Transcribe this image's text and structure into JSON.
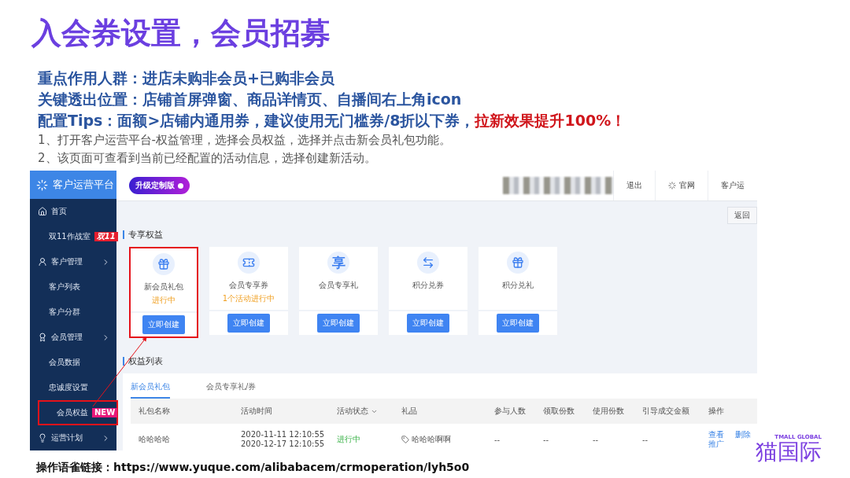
{
  "title": "入会券设置，会员招募",
  "key_points": [
    {
      "text": "重点作用人群：进店未购非会员+已购非会员"
    },
    {
      "text": "关键透出位置：店铺首屏弹窗、商品详情页、自播间右上角icon"
    },
    {
      "text": "配置Tips：面额>店铺内通用券，建议使用无门槛券/8折以下券，",
      "highlight": "拉新效果提升100%！"
    }
  ],
  "steps": [
    "1、打开客户运营平台-权益管理，选择会员权益，选择并点击新会员礼包功能。",
    "2、该页面可查看到当前已经配置的活动信息，选择创建新活动。"
  ],
  "app": {
    "brand": "客户运营平台",
    "upgrade_button": "升级定制版",
    "top_links": [
      {
        "label": "退出",
        "kind": "plain"
      },
      {
        "label": "官网",
        "kind": "icon"
      },
      {
        "label": "客户运",
        "kind": "plain"
      }
    ],
    "back_button": "返回",
    "sidebar": [
      {
        "label": "首页",
        "kind": "group",
        "annotated": false
      },
      {
        "label": "双11作战室",
        "kind": "sub",
        "badge": "双11",
        "annotated": false
      },
      {
        "label": "客户管理",
        "kind": "group",
        "annotated": false
      },
      {
        "label": "客户列表",
        "kind": "sub",
        "annotated": false
      },
      {
        "label": "客户分群",
        "kind": "sub",
        "annotated": false
      },
      {
        "label": "会员管理",
        "kind": "group",
        "annotated": false
      },
      {
        "label": "会员数据",
        "kind": "sub",
        "annotated": false
      },
      {
        "label": "忠诚度设置",
        "kind": "sub",
        "annotated": false
      },
      {
        "label": "会员权益",
        "kind": "sub",
        "badge": "NEW",
        "annotated": true
      },
      {
        "label": "运营计划",
        "kind": "group",
        "annotated": false
      }
    ],
    "benefits_title": "专享权益",
    "cards": [
      {
        "name": "新会员礼包",
        "status": "进行中",
        "button": "立即创建",
        "annotated": true
      },
      {
        "name": "会员专享券",
        "status": "1个活动进行中",
        "button": "立即创建",
        "annotated": false
      },
      {
        "name": "会员专享礼",
        "glyph": "享",
        "button": "立即创建",
        "annotated": false
      },
      {
        "name": "积分兑券",
        "button": "立即创建",
        "annotated": false
      },
      {
        "name": "积分兑礼",
        "button": "立即创建",
        "annotated": false
      }
    ],
    "list_title": "权益列表",
    "tabs": [
      {
        "label": "新会员礼包",
        "selected": true
      },
      {
        "label": "会员专享礼/券",
        "selected": false
      }
    ],
    "table": {
      "columns": [
        "礼包名称",
        "活动时间",
        "活动状态",
        "礼品",
        "参与人数",
        "领取份数",
        "使用份数",
        "引导成交金额",
        "操作"
      ],
      "rows": [
        {
          "name": "哈哈哈哈",
          "time": [
            "2020-11-11 12:10:55",
            "2020-12-17 12:10:55"
          ],
          "status": "进行中",
          "gift": "哈哈哈啊啊",
          "participants": "--",
          "received": "--",
          "used": "--",
          "amount": "--",
          "actions": [
            "查看",
            "删除",
            "推广"
          ]
        }
      ]
    }
  },
  "footer": {
    "label": "操作语雀链接：",
    "url": "https://www.yuque.com/alibabacem/crmoperation/lyh5o0"
  },
  "logo": {
    "tagline": "TMALL GLOBAL",
    "name": "猫国际"
  }
}
